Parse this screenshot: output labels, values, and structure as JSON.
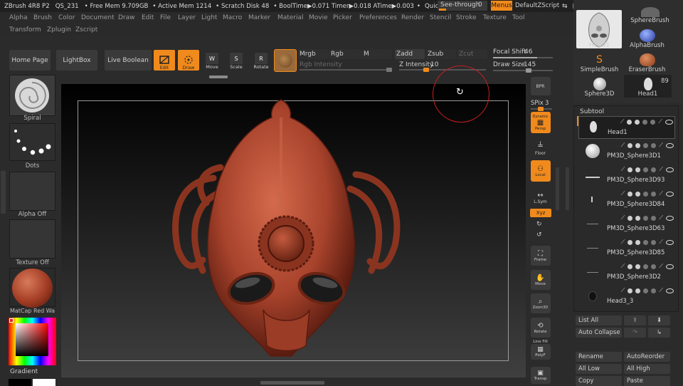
{
  "titlebar": {
    "app": "ZBrush 4R8 P2",
    "qs": "QS_231",
    "free_mem": "• Free Mem 9.709GB",
    "active_mem": "• Active Mem 1214",
    "scratch": "• Scratch Disk 48",
    "booltime": "• BoolTime▶0.071 Timer▶0.018 ATime▶0.003",
    "bullet": "•",
    "quicksave": "QuickSave",
    "seethrough": "See-through",
    "seethrough_value": "0",
    "menus": "Menus",
    "defaultzscript": "DefaultZScript"
  },
  "menu": {
    "row1": [
      "Alpha",
      "Brush",
      "Color",
      "Document",
      "Draw",
      "Edit",
      "File",
      "Layer",
      "Light",
      "Macro",
      "Marker",
      "Material",
      "Movie",
      "Picker",
      "Preferences",
      "Render",
      "Stencil",
      "Stroke",
      "Texture",
      "Tool"
    ],
    "row2": [
      "Transform",
      "Zplugin",
      "Zscript"
    ]
  },
  "toolbar": {
    "home": "Home Page",
    "lightbox": "LightBox",
    "live_boolean": "Live Boolean",
    "edit": "Edit",
    "draw": "Draw",
    "move": "Move",
    "scale": "Scale",
    "rotate": "Rotate",
    "mrgb": "Mrgb",
    "rgb": "Rgb",
    "m": "M",
    "zadd": "Zadd",
    "zsub": "Zsub",
    "zcut": "Zcut",
    "rgb_intensity": "Rgb Intensity",
    "z_intensity": "Z Intensity",
    "z_intensity_value": "10",
    "focal_shift": "Focal Shift",
    "focal_shift_value": "46",
    "draw_size": "Draw Size",
    "draw_size_value": "145"
  },
  "left_shelf": {
    "spiral": "Spiral",
    "dots": "Dots",
    "alpha_off": "Alpha Off",
    "texture_off": "Texture Off",
    "matcap": "MatCap Red Wa",
    "gradient": "Gradient"
  },
  "right_shelf": {
    "bpr": "BPR",
    "spix_label": "SPix",
    "spix_value": "3",
    "dynamic": "Dynamic",
    "persp": "Persp",
    "floor": "Floor",
    "local": "Local",
    "lsym": "L.Sym",
    "xyz": "Xyz",
    "frame": "Frame",
    "move": "Move",
    "zoom3d": "Zoom3D",
    "rotate": "Rotate",
    "linefill": "Line Fill",
    "polyf": "PolyF",
    "transp": "Transp"
  },
  "tool_panel": {
    "head1_top": "Head1",
    "spherebrush": "SphereBrush",
    "alphabrush": "AlphaBrush",
    "simplebrush": "SimpleBrush",
    "eraserbrush": "EraserBrush",
    "sphere3d": "Sphere3D",
    "head1": "Head1",
    "count": "89"
  },
  "subtool": {
    "title": "Subtool",
    "items": [
      "Head1",
      "PM3D_Sphere3D1",
      "PM3D_Sphere3D93",
      "PM3D_Sphere3D84",
      "PM3D_Sphere3D63",
      "PM3D_Sphere3D85",
      "PM3D_Sphere3D2",
      "Head3_3"
    ]
  },
  "subtool_buttons": {
    "list_all": "List All",
    "auto_collapse": "Auto Collapse",
    "rename": "Rename",
    "autoreorder": "AutoReorder",
    "all_low": "All Low",
    "all_high": "All High",
    "copy": "Copy",
    "paste": "Paste"
  },
  "colors": {
    "accent": "#f08a1c",
    "model": "#b24a32",
    "cursor_ring": "#c82020"
  }
}
